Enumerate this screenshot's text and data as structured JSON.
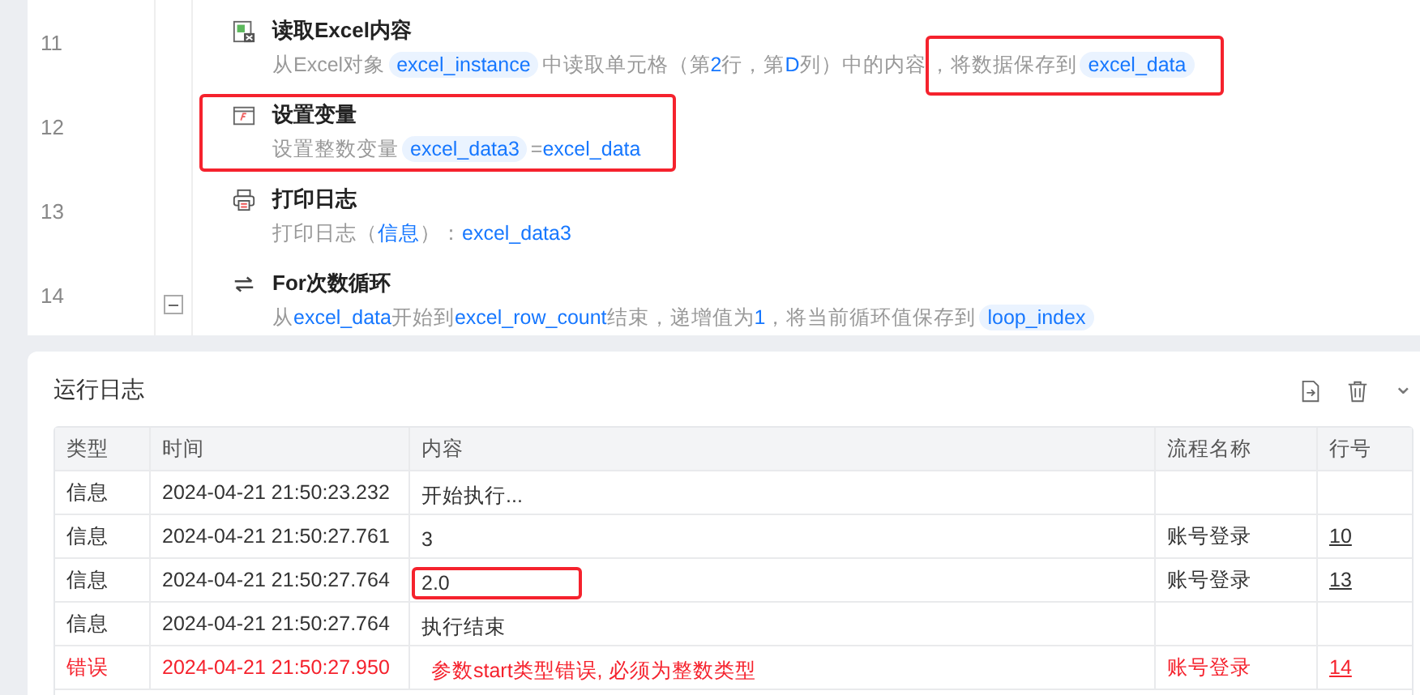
{
  "steps": [
    {
      "line": "11",
      "kind": "read",
      "title": "读取Excel内容",
      "desc": [
        {
          "kind": "text",
          "text": "从Excel对象"
        },
        {
          "kind": "var",
          "text": "excel_instance"
        },
        {
          "kind": "text",
          "text": "中读取单元格（第"
        },
        {
          "kind": "value",
          "text": "2"
        },
        {
          "kind": "text",
          "text": "行，第"
        },
        {
          "kind": "value",
          "text": "D"
        },
        {
          "kind": "text",
          "text": "列）中的内容"
        }
      ],
      "tail_marked": true,
      "tail": [
        {
          "kind": "text",
          "text": "，将数据保存到"
        },
        {
          "kind": "var",
          "text": "excel_data"
        }
      ]
    },
    {
      "line": "12",
      "kind": "set",
      "title": "设置变量",
      "marked": true,
      "desc": [
        {
          "kind": "text",
          "text": "设置整数变量"
        },
        {
          "kind": "var",
          "text": "excel_data3"
        },
        {
          "kind": "text",
          "text": "="
        },
        {
          "kind": "value",
          "text": "excel_data"
        }
      ]
    },
    {
      "line": "13",
      "kind": "print",
      "title": "打印日志",
      "desc": [
        {
          "kind": "text",
          "text": "打印日志（"
        },
        {
          "kind": "value",
          "text": "信息"
        },
        {
          "kind": "text",
          "text": "）："
        },
        {
          "kind": "value",
          "text": "excel_data3"
        }
      ]
    },
    {
      "line": "14",
      "kind": "loop",
      "title": "For次数循环",
      "expanded": true,
      "desc": [
        {
          "kind": "text",
          "text": "从"
        },
        {
          "kind": "value",
          "text": "excel_data"
        },
        {
          "kind": "text",
          "text": "开始到"
        },
        {
          "kind": "value",
          "text": "excel_row_count"
        },
        {
          "kind": "text",
          "text": "结束，递增值为"
        },
        {
          "kind": "value",
          "text": "1"
        },
        {
          "kind": "text",
          "text": "，将当前循环值保存到"
        },
        {
          "kind": "var",
          "text": "loop_index"
        }
      ]
    }
  ],
  "log": {
    "title": "运行日志",
    "fold_icon": "⌄",
    "columns": [
      "类型",
      "时间",
      "内容",
      "流程名称",
      "行号"
    ],
    "rows": [
      {
        "kind": "info",
        "type": "信息",
        "time": "2024-04-21 21:50:23.232",
        "content": "开始执行...",
        "marked": false
      },
      {
        "kind": "info",
        "type": "信息",
        "time": "2024-04-21 21:50:27.761",
        "content": "3",
        "marked": false,
        "flow": "账号登录",
        "line": "10"
      },
      {
        "kind": "info",
        "type": "信息",
        "time": "2024-04-21 21:50:27.764",
        "content": "2.0",
        "marked": true,
        "flow": "账号登录",
        "line": "13"
      },
      {
        "kind": "info",
        "type": "信息",
        "time": "2024-04-21 21:50:27.764",
        "content": "执行结束",
        "marked": false
      },
      {
        "kind": "error",
        "type": "错误",
        "time": "2024-04-21 21:50:27.950",
        "content": "参数start类型错误, 必须为整数类型",
        "marked": false,
        "flow": "账号登录",
        "line": "14"
      }
    ]
  }
}
